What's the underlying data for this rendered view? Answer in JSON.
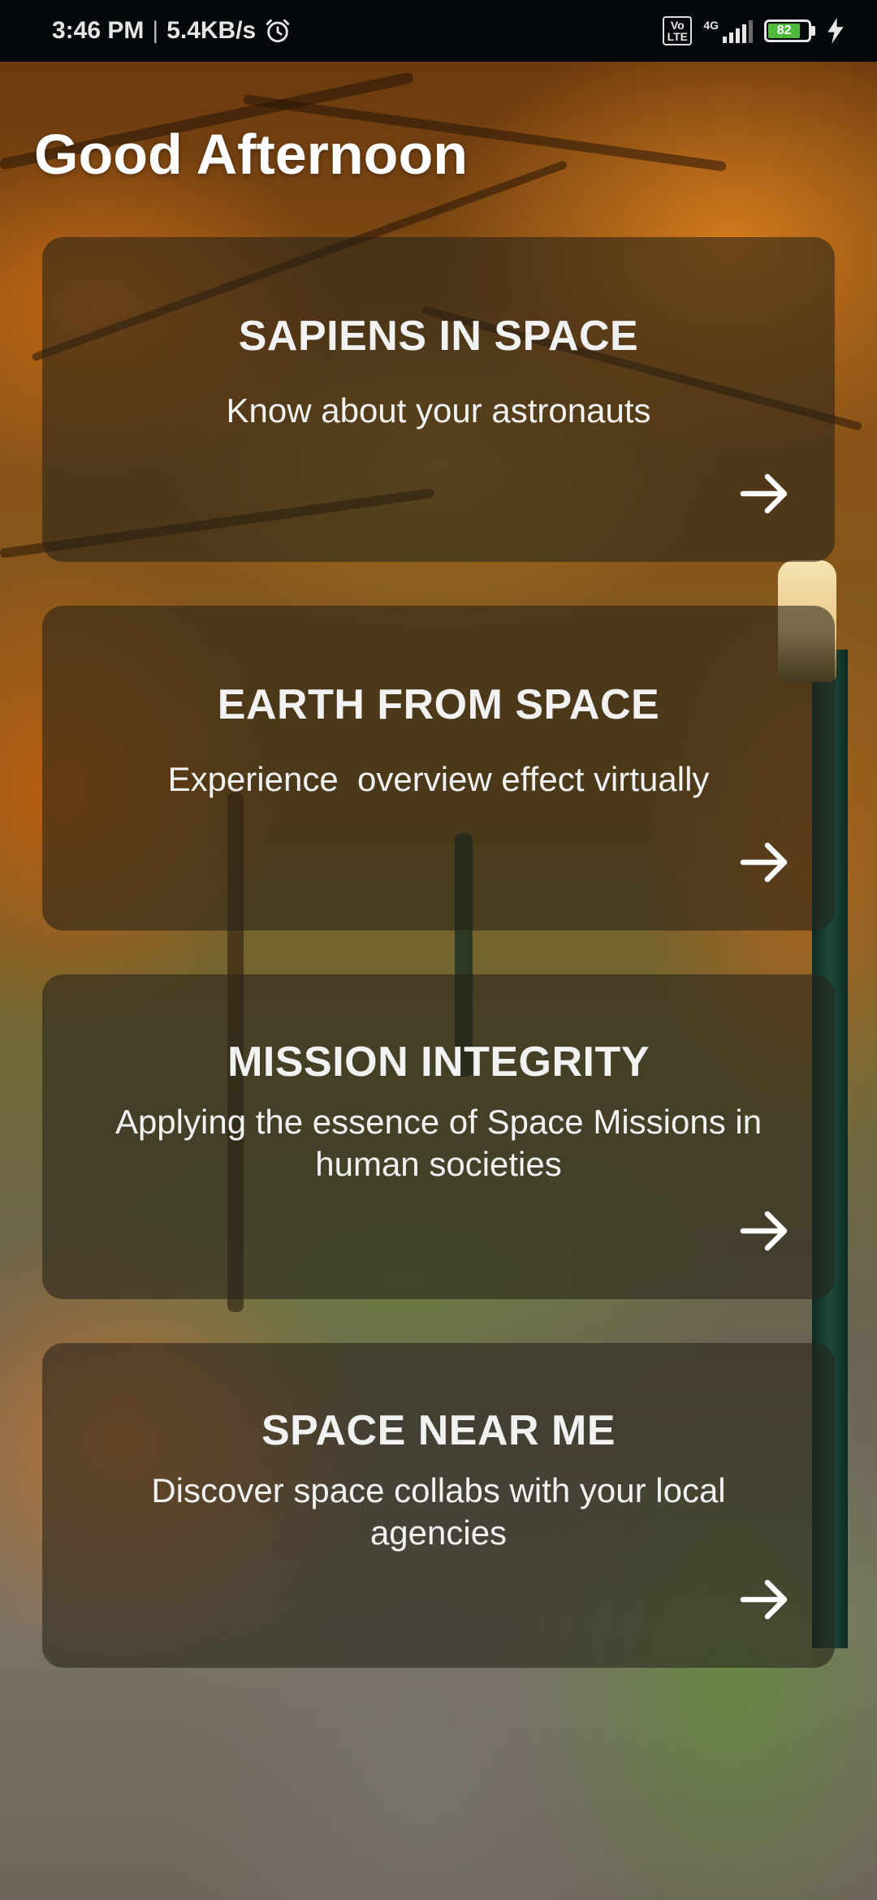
{
  "status_bar": {
    "time": "3:46 PM",
    "speed": "5.4KB/s",
    "alarm_icon": "alarm-clock-icon",
    "volte": "Vo\nLTE",
    "network": "4G",
    "battery": "82",
    "charging_icon": "lightning-bolt-icon"
  },
  "greeting": "Good Afternoon",
  "cards": [
    {
      "title": "SAPIENS IN SPACE",
      "subtitle": "Know about your astronauts",
      "arrow_icon": "arrow-right-icon"
    },
    {
      "title": "EARTH FROM SPACE",
      "subtitle": "Experience  overview effect virtually",
      "arrow_icon": "arrow-right-icon"
    },
    {
      "title": "MISSION INTEGRITY",
      "subtitle": "Applying the essence of Space Missions in human societies",
      "arrow_icon": "arrow-right-icon"
    },
    {
      "title": "SPACE NEAR ME",
      "subtitle": "Discover space collabs with your local agencies",
      "arrow_icon": "arrow-right-icon"
    }
  ],
  "colors": {
    "status_bar_bg": "#03090b",
    "card_overlay": "#262218",
    "text": "#f2f2f2",
    "battery_fill": "#4ebb3a"
  }
}
